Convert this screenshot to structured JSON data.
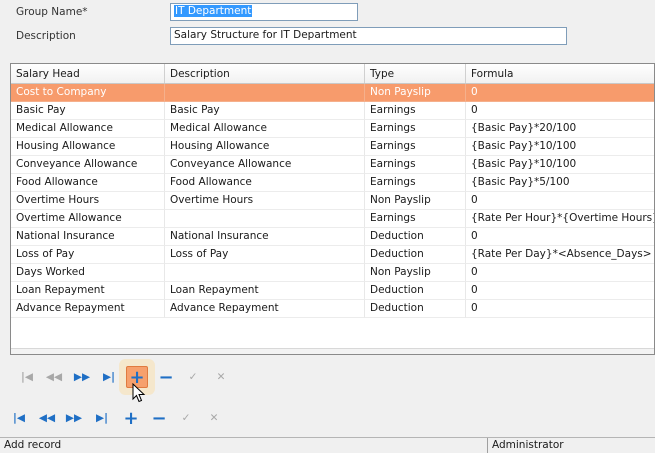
{
  "form": {
    "group_name_label": "Group Name*",
    "group_name_value": "IT Department",
    "description_label": "Description",
    "description_value": "Salary Structure for IT Department"
  },
  "grid": {
    "columns": [
      "Salary Head",
      "Description",
      "Type",
      "Formula"
    ],
    "rows": [
      [
        "Cost to Company",
        "",
        "Non Payslip",
        "0"
      ],
      [
        "Basic Pay",
        "Basic Pay",
        "Earnings",
        "0"
      ],
      [
        "Medical Allowance",
        "Medical Allowance",
        "Earnings",
        "{Basic Pay}*20/100"
      ],
      [
        "Housing Allowance",
        "Housing Allowance",
        "Earnings",
        "{Basic Pay}*10/100"
      ],
      [
        "Conveyance Allowance",
        "Conveyance Allowance",
        "Earnings",
        "{Basic Pay}*10/100"
      ],
      [
        "Food Allowance",
        "Food Allowance",
        "Earnings",
        "{Basic Pay}*5/100"
      ],
      [
        "Overtime Hours",
        "Overtime Hours",
        "Non Payslip",
        "0"
      ],
      [
        "Overtime Allowance",
        "",
        "Earnings",
        "{Rate Per Hour}*{Overtime Hours}"
      ],
      [
        "National Insurance",
        "National Insurance",
        "Deduction",
        "0"
      ],
      [
        "Loss of Pay",
        "Loss of Pay",
        "Deduction",
        "{Rate Per Day}*<Absence_Days>"
      ],
      [
        "Days Worked",
        "",
        "Non Payslip",
        "0"
      ],
      [
        "Loan Repayment",
        "Loan Repayment",
        "Deduction",
        "0"
      ],
      [
        "Advance Repayment",
        "Advance Repayment",
        "Deduction",
        "0"
      ]
    ],
    "selected_row": 0
  },
  "inner_nav": {
    "first": "first-record-icon",
    "prev": "previous-record-icon",
    "next": "next-record-icon",
    "last": "last-record-icon",
    "add": "add-icon",
    "delete": "delete-icon",
    "save": "check-icon",
    "cancel": "cancel-icon"
  },
  "status": {
    "message": "Add record",
    "user": "Administrator"
  },
  "colors": {
    "selected_row": "#f79b6c",
    "nav_active": "#1f6fc5",
    "nav_disabled": "#a8a8a8",
    "highlight_button": "#f6a06d"
  }
}
